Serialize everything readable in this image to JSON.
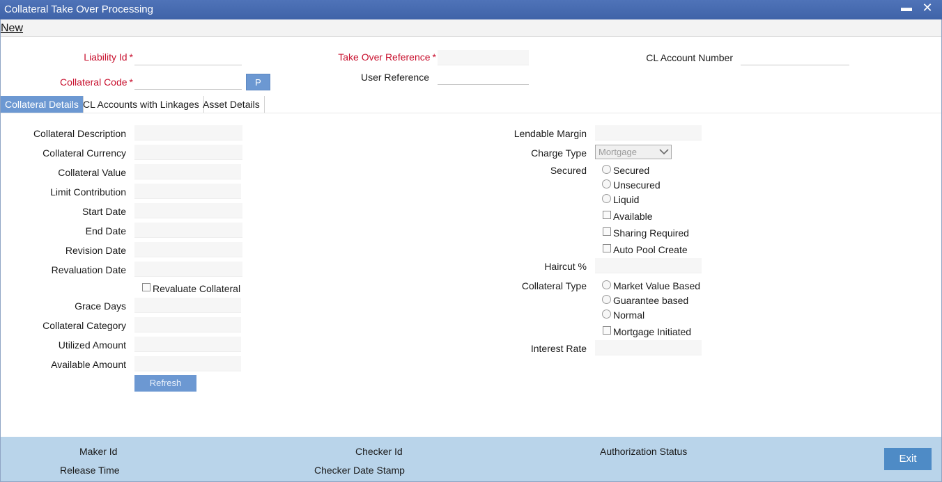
{
  "window": {
    "title": "Collateral Take Over Processing",
    "minimize": "▬",
    "close": "✕"
  },
  "menu": {
    "new": "New"
  },
  "header": {
    "liability_id": "Liability Id",
    "collateral_code": "Collateral Code",
    "p_button": "P",
    "take_over_reference": "Take Over Reference",
    "user_reference": "User Reference",
    "cl_account_number": "CL Account Number",
    "required_marker": "*"
  },
  "tabs": [
    "Collateral Details",
    "CL Accounts with Linkages",
    "Asset Details"
  ],
  "left": {
    "collateral_description": "Collateral Description",
    "collateral_currency": "Collateral Currency",
    "collateral_value": "Collateral Value",
    "limit_contribution": "Limit Contribution",
    "start_date": "Start Date",
    "end_date": "End Date",
    "revision_date": "Revision Date",
    "revaluation_date": "Revaluation Date",
    "revaluate_collateral": "Revaluate Collateral",
    "grace_days": "Grace Days",
    "collateral_category": "Collateral Category",
    "utilized_amount": "Utilized Amount",
    "available_amount": "Available Amount",
    "refresh": "Refresh"
  },
  "right": {
    "lendable_margin": "Lendable Margin",
    "charge_type": "Charge Type",
    "charge_type_value": "Mortgage",
    "secured": "Secured",
    "secured_options": [
      "Secured",
      "Unsecured",
      "Liquid"
    ],
    "available": "Available",
    "sharing_required": "Sharing Required",
    "auto_pool_create": "Auto Pool Create",
    "haircut": "Haircut %",
    "collateral_type": "Collateral Type",
    "collateral_type_options": [
      "Market Value Based",
      "Guarantee based",
      "Normal"
    ],
    "mortgage_initiated": "Mortgage Initiated",
    "interest_rate": "Interest Rate"
  },
  "footer": {
    "maker_id": "Maker Id",
    "release_time": "Release Time",
    "checker_id": "Checker Id",
    "checker_date_stamp": "Checker Date Stamp",
    "authorization_status": "Authorization Status",
    "exit": "Exit"
  },
  "colors": {
    "title_bar": "#4a6eb3",
    "accent": "#6c98d2",
    "required": "#c8102e",
    "footer": "#b9d4ea"
  }
}
